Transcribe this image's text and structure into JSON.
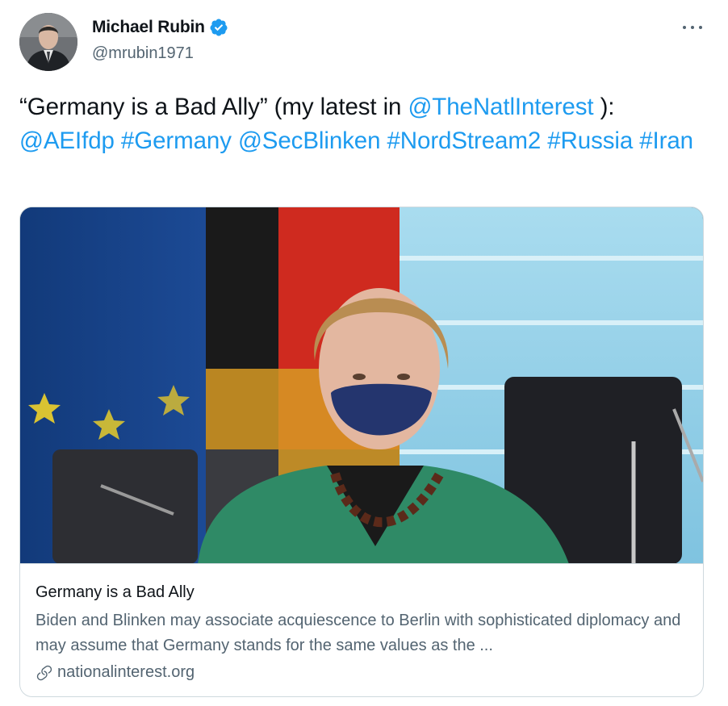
{
  "author": {
    "display_name": "Michael Rubin",
    "handle": "@mrubin1971",
    "verified": true,
    "avatar_icon": "profile-photo"
  },
  "more_icon": "more-options-icon",
  "tweet": {
    "segments": [
      {
        "text": "“Germany is a Bad Ally” (my latest in ",
        "type": "text"
      },
      {
        "text": "@TheNatlInterest",
        "type": "mention"
      },
      {
        "text": " ): ",
        "type": "text"
      },
      {
        "text": "@AEIfdp",
        "type": "mention"
      },
      {
        "text": " ",
        "type": "text"
      },
      {
        "text": "#Germany",
        "type": "hashtag"
      },
      {
        "text": " ",
        "type": "text"
      },
      {
        "text": "@SecBlinken",
        "type": "mention"
      },
      {
        "text": " ",
        "type": "text"
      },
      {
        "text": "#NordStream2",
        "type": "hashtag"
      },
      {
        "text": " ",
        "type": "text"
      },
      {
        "text": "#Russia",
        "type": "hashtag"
      },
      {
        "text": " ",
        "type": "text"
      },
      {
        "text": "#Iran",
        "type": "hashtag"
      }
    ]
  },
  "link_card": {
    "image_icon": "article-photo",
    "title": "Germany is a Bad Ally",
    "description": "Biden and Blinken may associate acquiescence to Berlin with sophisticated diplomacy and may assume that Germany stands for the same values as the ...",
    "domain": "nationalinterest.org",
    "domain_icon": "link-icon"
  },
  "colors": {
    "link": "#1d9bf0",
    "text": "#0f1419",
    "secondary": "#536471",
    "border": "#cfd9de"
  }
}
